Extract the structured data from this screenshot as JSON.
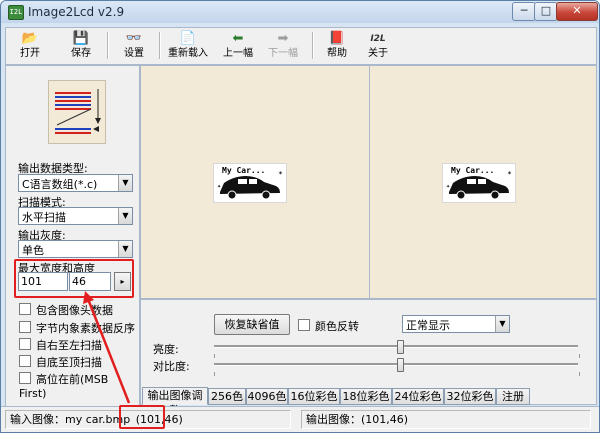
{
  "window": {
    "title": "Image2Lcd v2.9",
    "app_icon_text": "I2L"
  },
  "titlebar_buttons": {
    "minimize": "─",
    "maximize": "□",
    "close": "✕"
  },
  "toolbar": [
    {
      "id": "open",
      "label": "打开",
      "icon": "📂",
      "icon_name": "open-folder-icon",
      "enabled": true
    },
    {
      "id": "save",
      "label": "保存",
      "icon": "💾",
      "icon_name": "floppy-disk-icon",
      "enabled": true
    },
    {
      "id": "settings",
      "label": "设置",
      "icon": "👓",
      "icon_name": "glasses-icon",
      "enabled": true
    },
    {
      "id": "reload",
      "label": "重新载入",
      "icon": "📄",
      "icon_name": "reload-document-icon",
      "enabled": true
    },
    {
      "id": "prev",
      "label": "上一幅",
      "icon": "⬅",
      "icon_name": "left-arrow-icon",
      "enabled": true
    },
    {
      "id": "next",
      "label": "下一幅",
      "icon": "➡",
      "icon_name": "right-arrow-icon",
      "enabled": false
    },
    {
      "id": "help",
      "label": "帮助",
      "icon": "📕",
      "icon_name": "help-book-icon",
      "enabled": true
    },
    {
      "id": "about",
      "label": "关于",
      "icon": "I2L",
      "icon_name": "i2l-logo-icon",
      "enabled": true
    }
  ],
  "left_panel": {
    "output_type_label": "输出数据类型:",
    "output_type_value": "C语言数组(*.c)",
    "scan_mode_label": "扫描模式:",
    "scan_mode_value": "水平扫描",
    "gray_label": "输出灰度:",
    "gray_value": "单色",
    "max_size_label": "最大宽度和高度",
    "max_width": "101",
    "max_height": "46",
    "size_arrow": "▸",
    "checkboxes": [
      {
        "label": "包含图像头数据",
        "checked": false
      },
      {
        "label": "字节内象素数据反序",
        "checked": false
      },
      {
        "label": "自右至左扫描",
        "checked": false
      },
      {
        "label": "自底至顶扫描",
        "checked": false
      },
      {
        "label": "高位在前(MSB First)",
        "checked": false
      }
    ]
  },
  "preview": {
    "left_image_text": "My Car...",
    "right_image_text": "My Car..."
  },
  "adjust": {
    "restore_default": "恢复缺省值",
    "invert_color_label": "颜色反转",
    "invert_color_checked": false,
    "display_mode_value": "正常显示",
    "brightness_label": "亮度:",
    "contrast_label": "对比度:",
    "brightness_level_pct": 51,
    "contrast_level_pct": 51
  },
  "tabs": [
    "输出图像调整",
    "256色",
    "4096色",
    "16位彩色",
    "18位彩色",
    "24位彩色",
    "32位彩色",
    "注册"
  ],
  "statusbar": {
    "input_image": "输入图像：my car.bmp",
    "input_size": "(101,46)",
    "output_image": "输出图像：(101,46)"
  },
  "colors": {
    "annotation_red": "#e11f1f",
    "preview_bg": "#f2e9d6",
    "frame_bg": "#d7e4f2"
  }
}
